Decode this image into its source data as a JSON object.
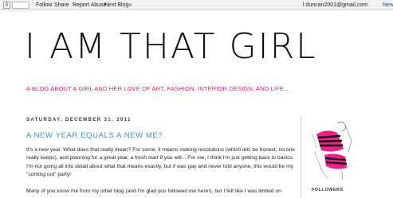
{
  "navbar": {
    "links": [
      "Follow",
      "Share",
      "Report Abuse",
      "Next Blog»"
    ],
    "email": "l.duncan2001@gmail.com",
    "new_post": "New"
  },
  "header": {
    "title": "I AM THAT GIRL",
    "description": "A BLOG ABOUT A GIRL AND HER LOVE OF ART, FASHION, INTERIOR DESIGN, AND LIFE..."
  },
  "post": {
    "date": "SATURDAY, DECEMBER 31, 2011",
    "title": "A NEW YEAR EQUALS A NEW ME?",
    "paragraphs": [
      "It's a new year. What does that really mean? For some, it means making resolutions (which lets be honest, no one really keeps), and planning for a great year, a fresh start if you will... For me, I think I'm just getting back to basics. I'm not going all into detail about what that means exactly, but if was gay and never told anyone, this would be my \"coming out\" party!",
      "Many of you know me from my other blog (and I'm glad you followed me here!), but I felt like I was limited on"
    ]
  },
  "sidebar": {
    "followers_title": "FOLLOWERS"
  },
  "colors": {
    "accent_pink": "#e8128a",
    "post_title_blue": "#3d8fbf"
  }
}
